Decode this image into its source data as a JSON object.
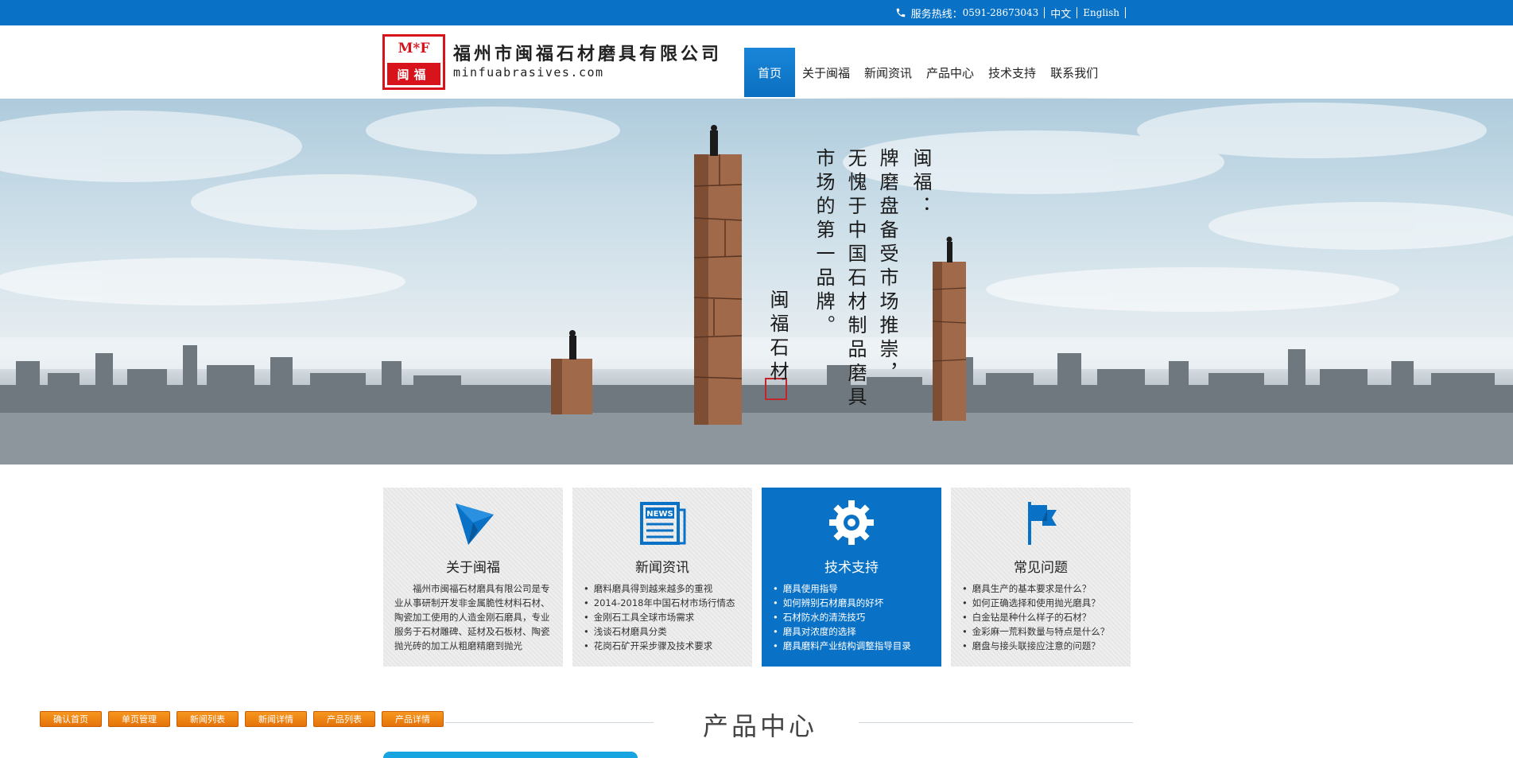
{
  "topbar": {
    "hotline_label": "服务热线：",
    "hotline_number": "0591-28673043",
    "lang_cn": "中文",
    "lang_en": "English"
  },
  "header": {
    "logo_top": "M*F",
    "logo_bottom": "闽福",
    "brand_cn": "福州市闽福石材磨具有限公司",
    "brand_en": "minfuabrasives.com"
  },
  "nav": {
    "items": [
      "首页",
      "关于闽福",
      "新闻资讯",
      "产品中心",
      "技术支持",
      "联系我们"
    ]
  },
  "banner": {
    "poem_lines": [
      "闽福：",
      "牌磨盘备受市场推崇，",
      "无愧于中国石材制品磨具",
      "市场的第一品牌。"
    ],
    "signature": "闽福石材"
  },
  "boxes": [
    {
      "title": "关于闽福",
      "icon": "paper-plane-icon",
      "paragraph": "福州市闽福石材磨具有限公司是专业从事研制开发非金属脆性材料石材、陶瓷加工使用的人造金刚石磨具，专业服务于石材雕碑、延材及石板材、陶瓷抛光砖的加工从粗磨精磨到抛光"
    },
    {
      "title": "新闻资讯",
      "icon": "newspaper-icon",
      "items": [
        "磨料磨具得到越来越多的重视",
        "2014-2018年中国石材市场行情态",
        "金刚石工具全球市场需求",
        "浅谈石材磨具分类",
        "花岗石矿开采步骤及技术要求"
      ]
    },
    {
      "title": "技术支持",
      "icon": "gear-icon",
      "items": [
        "磨具使用指导",
        "如何辨别石材磨具的好坏",
        "石材防水的清洗技巧",
        "磨具对浓度的选择",
        "磨具磨料产业结构调整指导目录"
      ]
    },
    {
      "title": "常见问题",
      "icon": "flag-icon",
      "items": [
        "磨具生产的基本要求是什么？",
        "如何正确选择和使用抛光磨具？",
        "白金钻是种什么样子的石材？",
        "金彩麻一荒料数量与特点是什么？",
        "磨盘与接头联接应注意的问题？"
      ]
    }
  ],
  "product_center": {
    "title": "产品中心"
  },
  "admin_bar": {
    "buttons": [
      "确认首页",
      "单页管理",
      "新闻列表",
      "新闻详情",
      "产品列表",
      "产品详情"
    ]
  },
  "colors": {
    "primary": "#0a72c6",
    "logo_red": "#d7131b",
    "admin_orange": "#f08a12"
  }
}
